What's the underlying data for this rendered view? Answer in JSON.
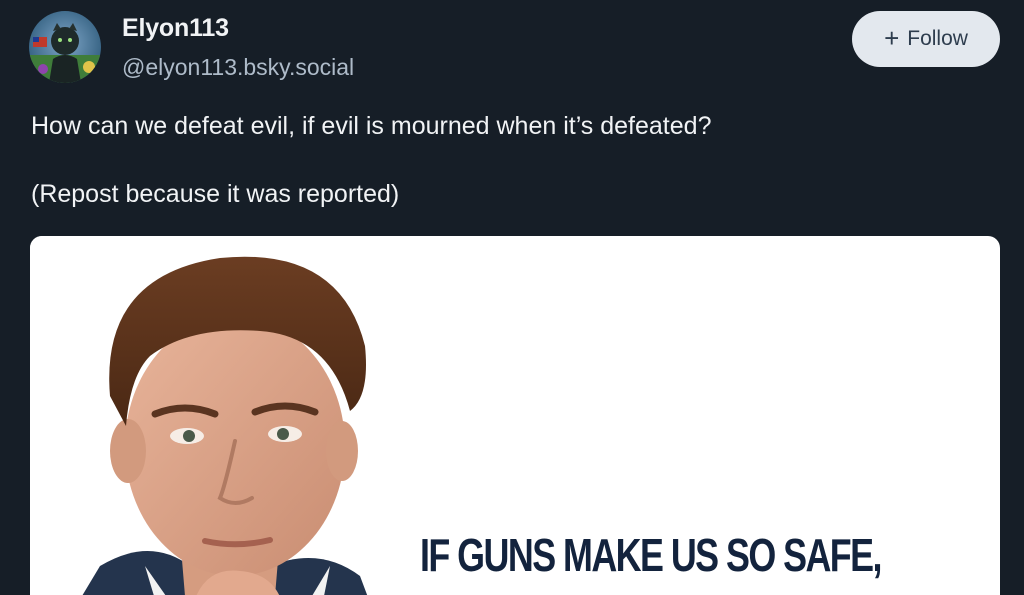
{
  "author": {
    "display_name": "Elyon113",
    "handle": "@elyon113.bsky.social"
  },
  "follow_button": {
    "icon": "plus-icon",
    "label": "Follow"
  },
  "post": {
    "text_line_1": "How can we defeat evil, if evil is mourned when it’s defeated?",
    "text_line_2": "(Repost because it was reported)"
  },
  "media": {
    "caption": "IF GUNS MAKE US SO SAFE,"
  },
  "colors": {
    "background": "#161e27",
    "text_primary": "#f1f3f5",
    "text_secondary": "#aebbc9",
    "follow_button_bg": "#e3e8ee",
    "follow_button_text": "#2e3d4e",
    "caption_text": "#13233d"
  }
}
